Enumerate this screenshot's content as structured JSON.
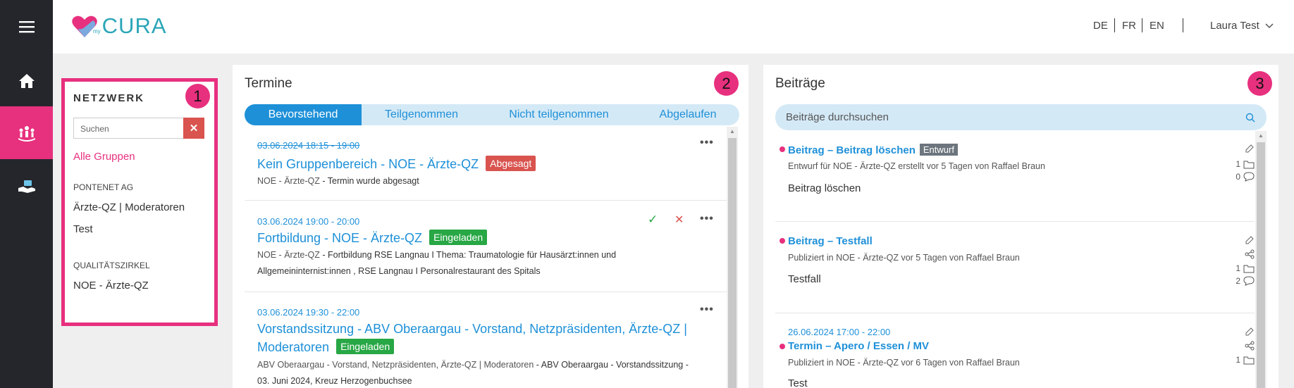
{
  "app": {
    "logo_prefix": "my",
    "logo_text": "CURA",
    "languages": [
      "DE",
      "FR",
      "EN"
    ],
    "user_name": "Laura Test"
  },
  "rail": {
    "icons": [
      "menu-icon",
      "home-icon",
      "network-icon",
      "handshake-icon"
    ],
    "active_color": "#e7307e"
  },
  "network": {
    "title": "NETZWERK",
    "badge": "1",
    "search_placeholder": "Suchen",
    "clear_label": "✕",
    "all_groups": "Alle Gruppen",
    "sections": [
      {
        "heading": "PONTENET AG",
        "items": [
          "Ärzte-QZ | Moderatoren",
          "Test"
        ]
      },
      {
        "heading": "QUALITÄTSZIRKEL",
        "items": [
          "NOE - Ärzte-QZ"
        ]
      }
    ]
  },
  "termine": {
    "title": "Termine",
    "badge": "2",
    "tabs": [
      "Bevorstehend",
      "Teilgenommen",
      "Nicht teilgenommen",
      "Abgelaufen"
    ],
    "active_tab": "Bevorstehend",
    "events": [
      {
        "date": "03.06.2024 18:15 - 19:00",
        "title": "Kein Gruppenbereich - NOE - Ärzte-QZ",
        "status": "Abgesagt",
        "meta_group": "NOE - Ärzte-QZ",
        "meta_text": " - Termin wurde abgesagt"
      },
      {
        "date": "03.06.2024 19:00 - 20:00",
        "title": "Fortbildung - NOE - Ärzte-QZ",
        "status": "Eingeladen",
        "meta_group": "NOE - Ärzte-QZ",
        "meta_text": " - Fortbildung RSE Langnau I Thema: Traumatologie für Hausärzt:innen und",
        "meta_text_2": "Allgemeininternist:innen , RSE Langnau I Personalrestaurant des Spitals",
        "accept_icon": "✓",
        "decline_icon": "✕"
      },
      {
        "date": "03.06.2024 19:30 - 22:00",
        "title": "Vorstandssitzung - ABV Oberaargau - Vorstand, Netzpräsidenten, Ärzte-QZ |",
        "title_2": "Moderatoren",
        "status": "Eingeladen",
        "meta_group": "ABV Oberaargau - Vorstand, Netzpräsidenten, Ärzte-QZ | Moderatoren",
        "meta_text": " - ABV Oberaargau - Vorstandssitzung -",
        "meta_text_2": "03. Juni 2024, Kreuz Herzogenbuchsee"
      }
    ],
    "more_icon": "•••"
  },
  "beitraege": {
    "title": "Beiträge",
    "badge": "3",
    "search_placeholder": "Beiträge durchsuchen",
    "posts": [
      {
        "title": "Beitrag – Beitrag löschen",
        "tag": "Entwurf",
        "meta": "Entwurf für NOE - Ärzte-QZ erstellt vor 5 Tagen von Raffael Braun",
        "body": "Beitrag löschen",
        "folder_count": "1",
        "comment_count": "0"
      },
      {
        "title": "Beitrag – Testfall",
        "meta": "Publiziert in NOE - Ärzte-QZ vor 5 Tagen von Raffael Braun",
        "body": "Testfall",
        "folder_count": "1",
        "comment_count": "2"
      },
      {
        "date": "26.06.2024 17:00 - 22:00",
        "title": "Termin – Apero / Essen / MV",
        "meta": "Publiziert in NOE - Ärzte-QZ vor 6 Tagen von Raffael Braun",
        "body": "Test",
        "folder_count": "1"
      }
    ]
  }
}
